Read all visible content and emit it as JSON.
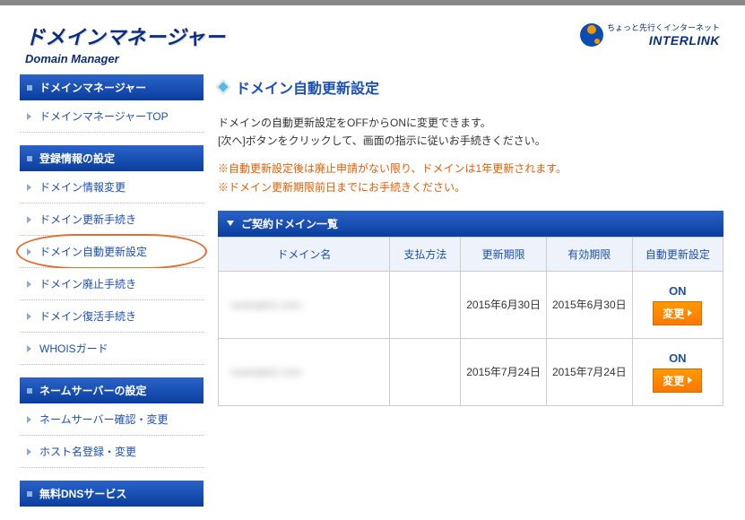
{
  "brand": {
    "title": "ドメインマネージャー",
    "subtitle": "Domain Manager"
  },
  "interlink": {
    "tagline": "ちょっと先行くインターネット",
    "name": "INTERLINK"
  },
  "sidebar": {
    "sections": [
      {
        "header": "ドメインマネージャー",
        "items": [
          {
            "label": "ドメインマネージャーTOP"
          }
        ]
      },
      {
        "header": "登録情報の設定",
        "items": [
          {
            "label": "ドメイン情報変更"
          },
          {
            "label": "ドメイン更新手続き"
          },
          {
            "label": "ドメイン自動更新設定",
            "active": true
          },
          {
            "label": "ドメイン廃止手続き"
          },
          {
            "label": "ドメイン復活手続き"
          },
          {
            "label": "WHOISガード"
          }
        ]
      },
      {
        "header": "ネームサーバーの設定",
        "items": [
          {
            "label": "ネームサーバー確認・変更"
          },
          {
            "label": "ホスト名登録・変更"
          }
        ]
      },
      {
        "header": "無料DNSサービス",
        "items": []
      }
    ]
  },
  "main": {
    "title": "ドメイン自動更新設定",
    "intro1": "ドメインの自動更新設定をOFFからONに変更できます。",
    "intro2": "[次へ]ボタンをクリックして、画面の指示に従いお手続きください。",
    "notice1": "※自動更新設定後は廃止申請がない限り、ドメインは1年更新されます。",
    "notice2": "※ドメイン更新期限前日までにお手続きください。",
    "tableTitle": "ご契約ドメイン一覧",
    "columns": {
      "domain": "ドメイン名",
      "payment": "支払方法",
      "renewal": "更新期限",
      "expiry": "有効期限",
      "auto": "自動更新設定"
    },
    "rows": [
      {
        "domain": "example1.com",
        "payment": "",
        "renewal": "2015年6月30日",
        "expiry": "2015年6月30日",
        "auto": "ON",
        "change": "変更"
      },
      {
        "domain": "example2.com",
        "payment": "",
        "renewal": "2015年7月24日",
        "expiry": "2015年7月24日",
        "auto": "ON",
        "change": "変更"
      }
    ]
  }
}
